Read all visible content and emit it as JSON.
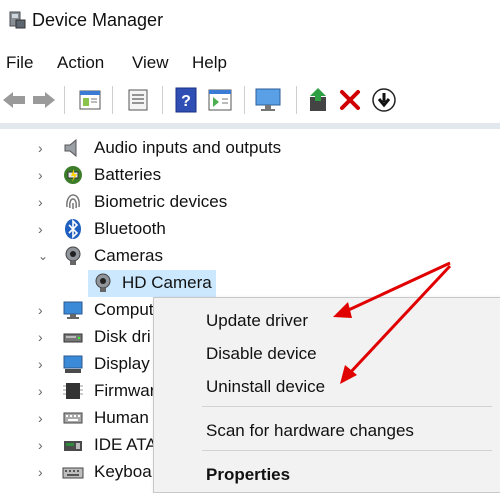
{
  "window": {
    "title": "Device Manager"
  },
  "menubar": {
    "items": [
      "File",
      "Action",
      "View",
      "Help"
    ]
  },
  "toolbar": {
    "icons": [
      "back-arrow-icon",
      "forward-arrow-icon",
      "properties-window-icon",
      "show-hidden-icon",
      "help-icon",
      "action-pane-icon",
      "scan-monitor-icon",
      "update-driver-icon",
      "uninstall-x-icon",
      "disable-device-icon"
    ]
  },
  "tree": {
    "categories": [
      {
        "label": "Audio inputs and outputs",
        "icon": "speaker-icon"
      },
      {
        "label": "Batteries",
        "icon": "battery-icon"
      },
      {
        "label": "Biometric devices",
        "icon": "fingerprint-icon"
      },
      {
        "label": "Bluetooth",
        "icon": "bluetooth-icon"
      },
      {
        "label": "Cameras",
        "icon": "webcam-icon",
        "expanded": true,
        "children": [
          {
            "label": "HD Camera",
            "icon": "webcam-icon",
            "selected": true
          }
        ]
      },
      {
        "label": "Comput",
        "icon": "computer-icon"
      },
      {
        "label": "Disk dri",
        "icon": "disk-drive-icon"
      },
      {
        "label": "Display",
        "icon": "display-adapter-icon"
      },
      {
        "label": "Firmwar",
        "icon": "firmware-chip-icon"
      },
      {
        "label": "Human",
        "icon": "keyboard-hid-icon"
      },
      {
        "label": "IDE ATA",
        "icon": "ide-controller-icon"
      },
      {
        "label": "Keyboa",
        "icon": "keyboard-icon"
      }
    ]
  },
  "context_menu": {
    "update_driver": "Update driver",
    "disable_device": "Disable device",
    "uninstall_device": "Uninstall device",
    "scan_for_changes": "Scan for hardware changes",
    "properties": "Properties"
  },
  "colors": {
    "selection": "#cce8ff",
    "arrow": "#e00000",
    "menu_bg": "#f2f2f2"
  }
}
